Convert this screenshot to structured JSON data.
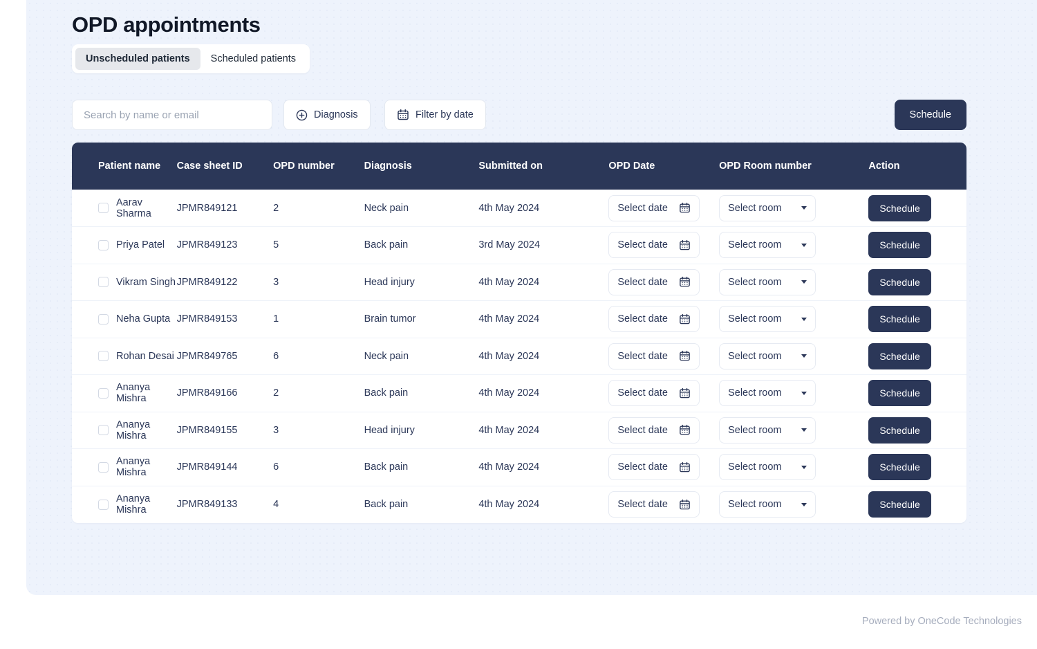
{
  "page": {
    "title": "OPD appointments"
  },
  "tabs": [
    {
      "label": "Unscheduled patients",
      "active": true
    },
    {
      "label": "Scheduled patients",
      "active": false
    }
  ],
  "toolbar": {
    "search_placeholder": "Search by name or email",
    "search_value": "",
    "diagnosis_label": "Diagnosis",
    "diagnosis_icon": "plus-circle-icon",
    "filter_date_label": "Filter by date",
    "filter_date_icon": "calendar-icon",
    "schedule_label": "Schedule"
  },
  "table": {
    "columns": [
      "Patient name",
      "Case sheet ID",
      "OPD number",
      "Diagnosis",
      "Submitted on",
      "OPD Date",
      "OPD Room number",
      "Action"
    ],
    "row_controls": {
      "date_label": "Select date",
      "date_icon": "calendar-icon",
      "room_label": "Select room",
      "room_icon": "chevron-down-icon",
      "action_label": "Schedule"
    },
    "rows": [
      {
        "name": "Aarav Sharma",
        "case_id": "JPMR849121",
        "opd_number": "2",
        "diagnosis": "Neck pain",
        "submitted_on": "4th May 2024"
      },
      {
        "name": "Priya Patel",
        "case_id": "JPMR849123",
        "opd_number": "5",
        "diagnosis": "Back pain",
        "submitted_on": "3rd May 2024"
      },
      {
        "name": "Vikram Singh",
        "case_id": "JPMR849122",
        "opd_number": "3",
        "diagnosis": "Head injury",
        "submitted_on": "4th May 2024"
      },
      {
        "name": "Neha Gupta",
        "case_id": "JPMR849153",
        "opd_number": "1",
        "diagnosis": "Brain tumor",
        "submitted_on": "4th May 2024"
      },
      {
        "name": "Rohan Desai",
        "case_id": "JPMR849765",
        "opd_number": "6",
        "diagnosis": "Neck pain",
        "submitted_on": "4th May 2024"
      },
      {
        "name": "Ananya Mishra",
        "case_id": "JPMR849166",
        "opd_number": "2",
        "diagnosis": "Back pain",
        "submitted_on": "4th May 2024"
      },
      {
        "name": "Ananya Mishra",
        "case_id": "JPMR849155",
        "opd_number": "3",
        "diagnosis": "Head injury",
        "submitted_on": "4th May 2024"
      },
      {
        "name": "Ananya Mishra",
        "case_id": "JPMR849144",
        "opd_number": "6",
        "diagnosis": "Back pain",
        "submitted_on": "4th May 2024"
      },
      {
        "name": "Ananya Mishra",
        "case_id": "JPMR849133",
        "opd_number": "4",
        "diagnosis": "Back pain",
        "submitted_on": "4th May 2024"
      }
    ]
  },
  "footer": {
    "text": "Powered by OneCode Technologies"
  },
  "colors": {
    "navy": "#2b3758",
    "panel_bg": "#eef3fc",
    "page_bg": "#ffffff",
    "muted_text": "#a6adbd"
  }
}
